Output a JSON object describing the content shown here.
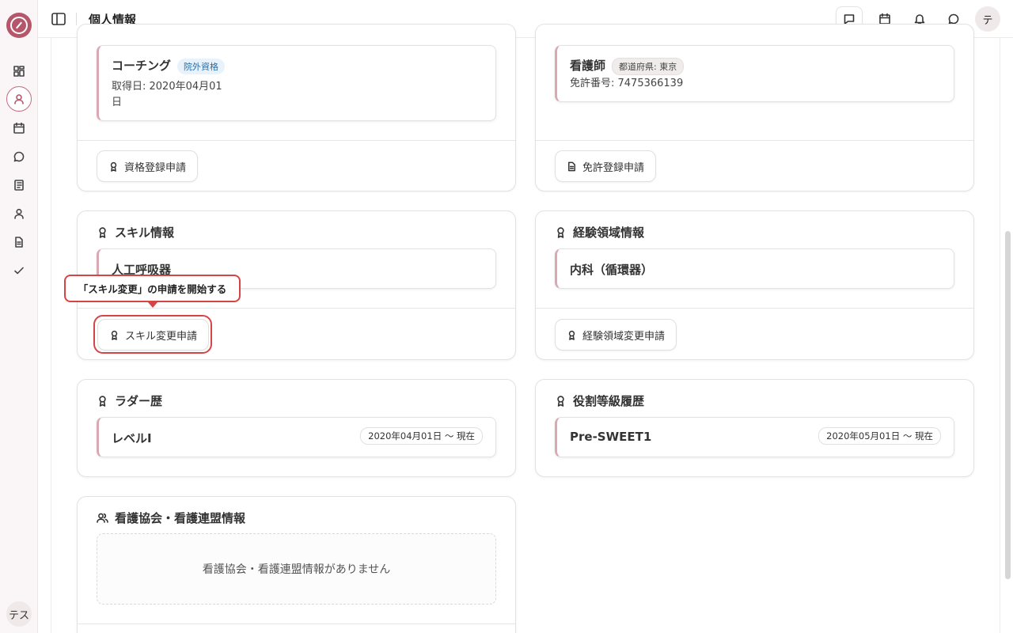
{
  "header": {
    "title": "個人情報",
    "avatar_text": "テ"
  },
  "sidebar": {
    "user_badge": "テス"
  },
  "cards": {
    "qualification": {
      "item_title": "コーチング",
      "item_badge": "院外資格",
      "item_date": "取得日: 2020年04月01日",
      "button_label": "資格登録申請"
    },
    "license": {
      "item_title": "看護師",
      "item_badge": "都道府県: 東京",
      "item_number": "免許番号: 7475366139",
      "button_label": "免許登録申請"
    },
    "skill": {
      "title": "スキル情報",
      "item_title": "人工呼吸器",
      "button_label": "スキル変更申請"
    },
    "experience": {
      "title": "経験領域情報",
      "item_title": "内科（循環器）",
      "button_label": "経験領域変更申請"
    },
    "ladder": {
      "title": "ラダー歴",
      "item_title": "レベルI",
      "item_period": "2020年04月01日 〜 現在"
    },
    "role": {
      "title": "役割等級履歴",
      "item_title": "Pre-SWEET1",
      "item_period": "2020年05月01日 〜 現在"
    },
    "association": {
      "title": "看護協会・看護連盟情報",
      "empty_text": "看護協会・看護連盟情報がありません"
    }
  },
  "tooltip": {
    "text": "「スキル変更」の申請を開始する"
  },
  "colors": {
    "brand": "#b5566b",
    "highlight": "#d64545",
    "accent_border": "#d8a9b3"
  }
}
